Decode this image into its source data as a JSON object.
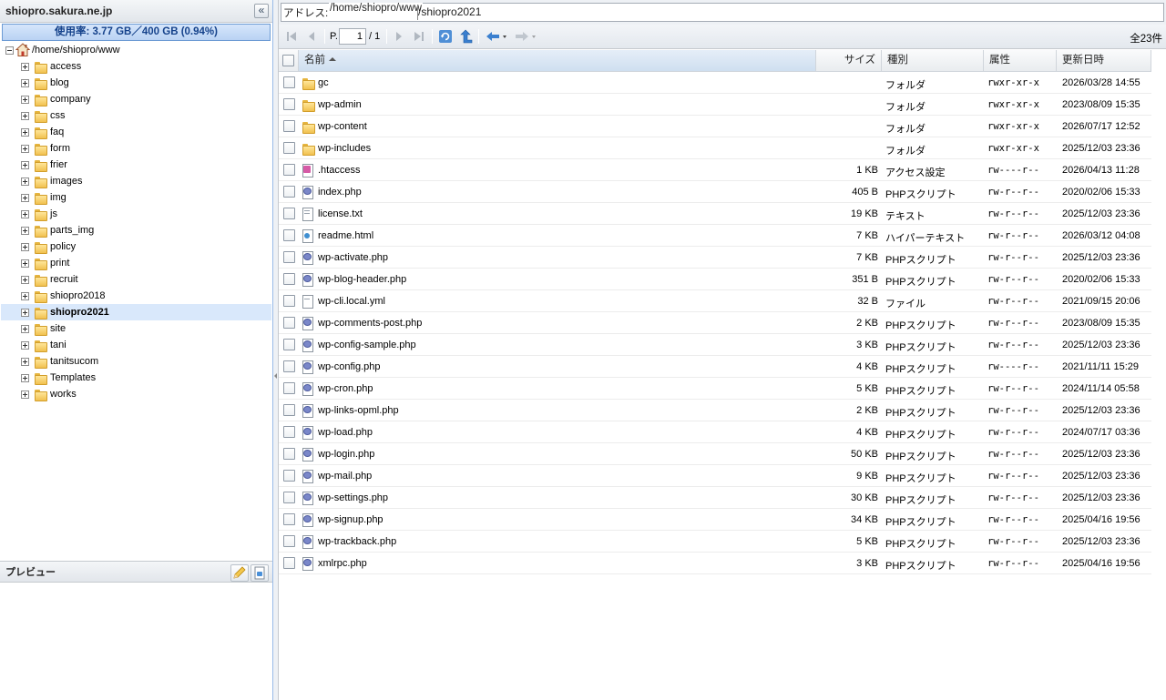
{
  "left": {
    "host": "shiopro.sakura.ne.jp",
    "collapse_glyph": "«",
    "usage": "使用率: 3.77 GB／400 GB (0.94%)",
    "root": "/home/shiopro/www",
    "tree": [
      {
        "label": "access"
      },
      {
        "label": "blog"
      },
      {
        "label": "company"
      },
      {
        "label": "css"
      },
      {
        "label": "faq"
      },
      {
        "label": "form"
      },
      {
        "label": "frier"
      },
      {
        "label": "images"
      },
      {
        "label": "img"
      },
      {
        "label": "js"
      },
      {
        "label": "parts_img"
      },
      {
        "label": "policy"
      },
      {
        "label": "print"
      },
      {
        "label": "recruit"
      },
      {
        "label": "shiopro2018"
      },
      {
        "label": "shiopro2021",
        "selected": true
      },
      {
        "label": "site"
      },
      {
        "label": "tani"
      },
      {
        "label": "tanitsucom"
      },
      {
        "label": "Templates"
      },
      {
        "label": "works"
      }
    ],
    "preview_title": "プレビュー"
  },
  "address": {
    "label": "アドレス:",
    "segment1": "/home/shiopro/www",
    "segment2": "/shiopro2021"
  },
  "toolbar": {
    "page_label": "P.",
    "page_value": "1",
    "page_total": "/ 1",
    "count": "全23件"
  },
  "grid": {
    "headers": {
      "name": "名前",
      "size": "サイズ",
      "type": "種別",
      "attr": "属性",
      "date": "更新日時"
    },
    "rows": [
      {
        "icon": "folder",
        "name": "gc",
        "size": "",
        "type": "フォルダ",
        "attr": "rwxr-xr-x",
        "date": "2026/03/28 14:55"
      },
      {
        "icon": "folder",
        "name": "wp-admin",
        "size": "",
        "type": "フォルダ",
        "attr": "rwxr-xr-x",
        "date": "2023/08/09 15:35"
      },
      {
        "icon": "folder",
        "name": "wp-content",
        "size": "",
        "type": "フォルダ",
        "attr": "rwxr-xr-x",
        "date": "2026/07/17 12:52"
      },
      {
        "icon": "folder",
        "name": "wp-includes",
        "size": "",
        "type": "フォルダ",
        "attr": "rwxr-xr-x",
        "date": "2025/12/03 23:36"
      },
      {
        "icon": "ht",
        "name": ".htaccess",
        "size": "1 KB",
        "type": "アクセス設定",
        "attr": "rw----r--",
        "date": "2026/04/13 11:28"
      },
      {
        "icon": "php",
        "name": "index.php",
        "size": "405 B",
        "type": "PHPスクリプト",
        "attr": "rw-r--r--",
        "date": "2020/02/06 15:33"
      },
      {
        "icon": "txt",
        "name": "license.txt",
        "size": "19 KB",
        "type": "テキスト",
        "attr": "rw-r--r--",
        "date": "2025/12/03 23:36"
      },
      {
        "icon": "html",
        "name": "readme.html",
        "size": "7 KB",
        "type": "ハイパーテキスト",
        "attr": "rw-r--r--",
        "date": "2026/03/12 04:08"
      },
      {
        "icon": "php",
        "name": "wp-activate.php",
        "size": "7 KB",
        "type": "PHPスクリプト",
        "attr": "rw-r--r--",
        "date": "2025/12/03 23:36"
      },
      {
        "icon": "php",
        "name": "wp-blog-header.php",
        "size": "351 B",
        "type": "PHPスクリプト",
        "attr": "rw-r--r--",
        "date": "2020/02/06 15:33"
      },
      {
        "icon": "yml",
        "name": "wp-cli.local.yml",
        "size": "32 B",
        "type": "ファイル",
        "attr": "rw-r--r--",
        "date": "2021/09/15 20:06"
      },
      {
        "icon": "php",
        "name": "wp-comments-post.php",
        "size": "2 KB",
        "type": "PHPスクリプト",
        "attr": "rw-r--r--",
        "date": "2023/08/09 15:35"
      },
      {
        "icon": "php",
        "name": "wp-config-sample.php",
        "size": "3 KB",
        "type": "PHPスクリプト",
        "attr": "rw-r--r--",
        "date": "2025/12/03 23:36"
      },
      {
        "icon": "php",
        "name": "wp-config.php",
        "size": "4 KB",
        "type": "PHPスクリプト",
        "attr": "rw----r--",
        "date": "2021/11/11 15:29"
      },
      {
        "icon": "php",
        "name": "wp-cron.php",
        "size": "5 KB",
        "type": "PHPスクリプト",
        "attr": "rw-r--r--",
        "date": "2024/11/14 05:58"
      },
      {
        "icon": "php",
        "name": "wp-links-opml.php",
        "size": "2 KB",
        "type": "PHPスクリプト",
        "attr": "rw-r--r--",
        "date": "2025/12/03 23:36"
      },
      {
        "icon": "php",
        "name": "wp-load.php",
        "size": "4 KB",
        "type": "PHPスクリプト",
        "attr": "rw-r--r--",
        "date": "2024/07/17 03:36"
      },
      {
        "icon": "php",
        "name": "wp-login.php",
        "size": "50 KB",
        "type": "PHPスクリプト",
        "attr": "rw-r--r--",
        "date": "2025/12/03 23:36"
      },
      {
        "icon": "php",
        "name": "wp-mail.php",
        "size": "9 KB",
        "type": "PHPスクリプト",
        "attr": "rw-r--r--",
        "date": "2025/12/03 23:36"
      },
      {
        "icon": "php",
        "name": "wp-settings.php",
        "size": "30 KB",
        "type": "PHPスクリプト",
        "attr": "rw-r--r--",
        "date": "2025/12/03 23:36"
      },
      {
        "icon": "php",
        "name": "wp-signup.php",
        "size": "34 KB",
        "type": "PHPスクリプト",
        "attr": "rw-r--r--",
        "date": "2025/04/16 19:56"
      },
      {
        "icon": "php",
        "name": "wp-trackback.php",
        "size": "5 KB",
        "type": "PHPスクリプト",
        "attr": "rw-r--r--",
        "date": "2025/12/03 23:36"
      },
      {
        "icon": "php",
        "name": "xmlrpc.php",
        "size": "3 KB",
        "type": "PHPスクリプト",
        "attr": "rw-r--r--",
        "date": "2025/04/16 19:56"
      }
    ]
  },
  "colors": {
    "accent": "#15428b",
    "selection": "#d9e8fb",
    "folder": "#f1c14f"
  }
}
